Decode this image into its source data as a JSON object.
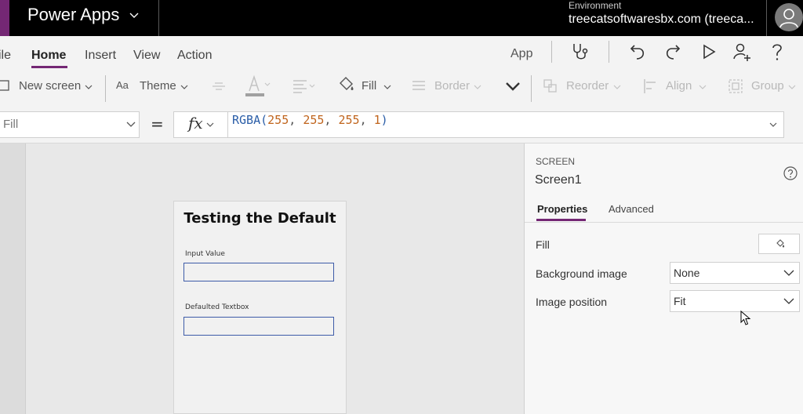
{
  "titlebar": {
    "app_name": "Power Apps",
    "environment_label": "Environment",
    "environment_value": "treecatsoftwaresbx.com (treeca..."
  },
  "menu": {
    "file": "ile",
    "home": "Home",
    "insert": "Insert",
    "view": "View",
    "action": "Action",
    "app": "App"
  },
  "toolbar": {
    "new_screen": "New screen",
    "theme": "Theme",
    "fill": "Fill",
    "border": "Border",
    "reorder": "Reorder",
    "align": "Align",
    "group": "Group"
  },
  "formula": {
    "property": "Fill",
    "fx": "fx",
    "fn": "RGBA(",
    "arg1": "255",
    "arg2": "255",
    "arg3": "255",
    "arg4": "1",
    "sep": ", ",
    "close": ")"
  },
  "canvas": {
    "title": "Testing the Default",
    "input_label": "Input Value",
    "defaulted_label": "Defaulted Textbox"
  },
  "panel": {
    "caption": "SCREEN",
    "name": "Screen1",
    "tab_properties": "Properties",
    "tab_advanced": "Advanced",
    "fill_label": "Fill",
    "bg_label": "Background image",
    "bg_value": "None",
    "pos_label": "Image position",
    "pos_value": "Fit"
  },
  "colors": {
    "accent": "#742774",
    "fn_blue": "#2b5ea8",
    "num_orange": "#c0641c"
  }
}
